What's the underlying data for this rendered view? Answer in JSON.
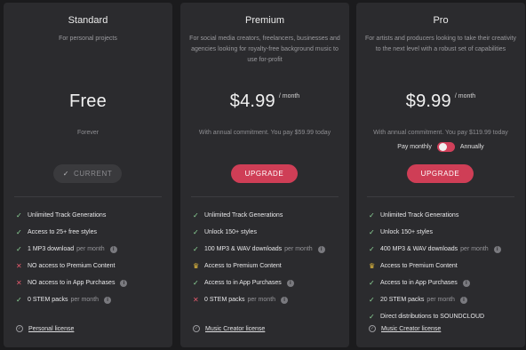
{
  "plans": [
    {
      "name": "Standard",
      "description": "For personal projects",
      "price": "Free",
      "period": "",
      "note": "Forever",
      "button": "CURRENT",
      "features": [
        {
          "mark": "✓",
          "text": "Unlimited Track Generations",
          "suffix": "",
          "info": false
        },
        {
          "mark": "✓",
          "text": "Access to 25+ free styles",
          "suffix": "",
          "info": false
        },
        {
          "mark": "✓",
          "text": "1 MP3 download",
          "suffix": "per month",
          "info": true
        },
        {
          "mark": "✕",
          "text": "NO access to Premium Content",
          "suffix": "",
          "info": false
        },
        {
          "mark": "✕",
          "text": "NO access to in App Purchases",
          "suffix": "",
          "info": true
        },
        {
          "mark": "✓",
          "text": "0 STEM packs",
          "suffix": "per month",
          "info": true
        }
      ],
      "license": "Personal license"
    },
    {
      "name": "Premium",
      "description": "For social media creators, freelancers, businesses and agencies looking for royalty-free background music to use for-profit",
      "price": "$4.99",
      "period": "/ month",
      "note": "With annual commitment. You pay $59.99 today",
      "button": "UPGRADE",
      "features": [
        {
          "mark": "✓",
          "text": "Unlimited Track Generations",
          "suffix": "",
          "info": false
        },
        {
          "mark": "✓",
          "text": "Unlock 150+ styles",
          "suffix": "",
          "info": false
        },
        {
          "mark": "✓",
          "text": "100 MP3 & WAV downloads",
          "suffix": "per month",
          "info": true
        },
        {
          "mark": "♛",
          "text": "Access to Premium Content",
          "suffix": "",
          "info": false
        },
        {
          "mark": "✓",
          "text": "Access to in App Purchases",
          "suffix": "",
          "info": true
        },
        {
          "mark": "✕",
          "text": "0 STEM packs",
          "suffix": "per month",
          "info": true
        }
      ],
      "license": "Music Creator license"
    },
    {
      "name": "Pro",
      "description": "For artists and producers looking to take their creativity to the next level with a robust set of capabilities",
      "price": "$9.99",
      "period": "/ month",
      "note": "With annual commitment. You pay $119.99 today",
      "toggle_left": "Pay monthly",
      "toggle_right": "Annually",
      "button": "UPGRADE",
      "features": [
        {
          "mark": "✓",
          "text": "Unlimited Track Generations",
          "suffix": "",
          "info": false
        },
        {
          "mark": "✓",
          "text": "Unlock 150+ styles",
          "suffix": "",
          "info": false
        },
        {
          "mark": "✓",
          "text": "400 MP3 & WAV downloads",
          "suffix": "per month",
          "info": true
        },
        {
          "mark": "♛",
          "text": "Access to Premium Content",
          "suffix": "",
          "info": false
        },
        {
          "mark": "✓",
          "text": "Access to in App Purchases",
          "suffix": "",
          "info": true
        },
        {
          "mark": "✓",
          "text": "20 STEM packs",
          "suffix": "per month",
          "info": true
        },
        {
          "mark": "✓",
          "text": "Direct distributions to SOUNDCLOUD",
          "suffix": "",
          "info": false
        }
      ],
      "license": "Music Creator license"
    }
  ],
  "icons": {
    "check": "check-icon",
    "cross": "cross-icon",
    "crown": "crown-icon",
    "info": "info-icon",
    "license": "license-badge-icon"
  },
  "colors": {
    "accent": "#cf3e56",
    "check": "#8fd89a",
    "cross": "#e25a6c",
    "crown": "#e8bf3f"
  }
}
